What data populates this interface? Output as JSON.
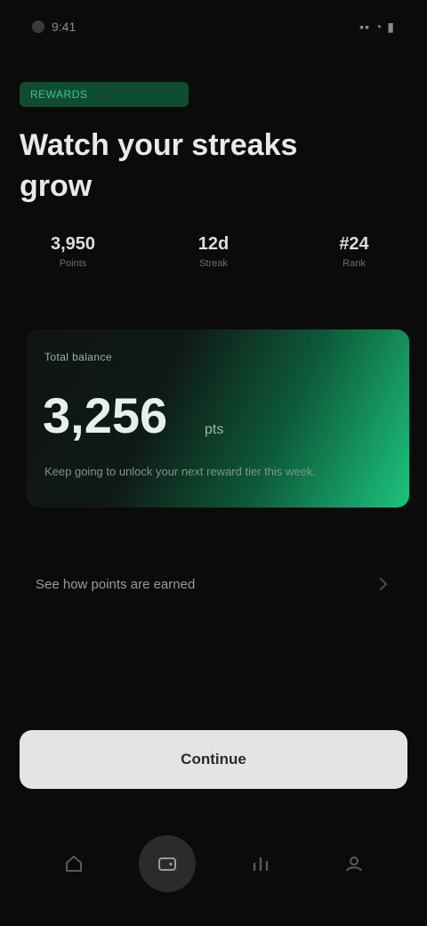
{
  "status_bar": {
    "time": "9:41",
    "indicators": "▪▪ ◔ ▮"
  },
  "eyebrow": "Rewards",
  "headline": "Watch your streaks grow",
  "stats": [
    {
      "value": "3,950",
      "label": "Points"
    },
    {
      "value": "12d",
      "label": "Streak"
    },
    {
      "value": "#24",
      "label": "Rank"
    }
  ],
  "hero": {
    "label": "Total balance",
    "value": "3,256",
    "unit": "pts",
    "subtitle": "Keep going to unlock your next reward tier this week."
  },
  "link": {
    "label": "See how points are earned"
  },
  "cta": {
    "label": "Continue"
  },
  "tabs": [
    {
      "icon": "home-icon"
    },
    {
      "icon": "wallet-icon"
    },
    {
      "icon": "chart-icon"
    },
    {
      "icon": "profile-icon"
    }
  ],
  "colors": {
    "background": "#0b0b0c",
    "accent": "#1cc47f",
    "accent_dark": "#0e4d33",
    "button": "#e4e4e6"
  }
}
